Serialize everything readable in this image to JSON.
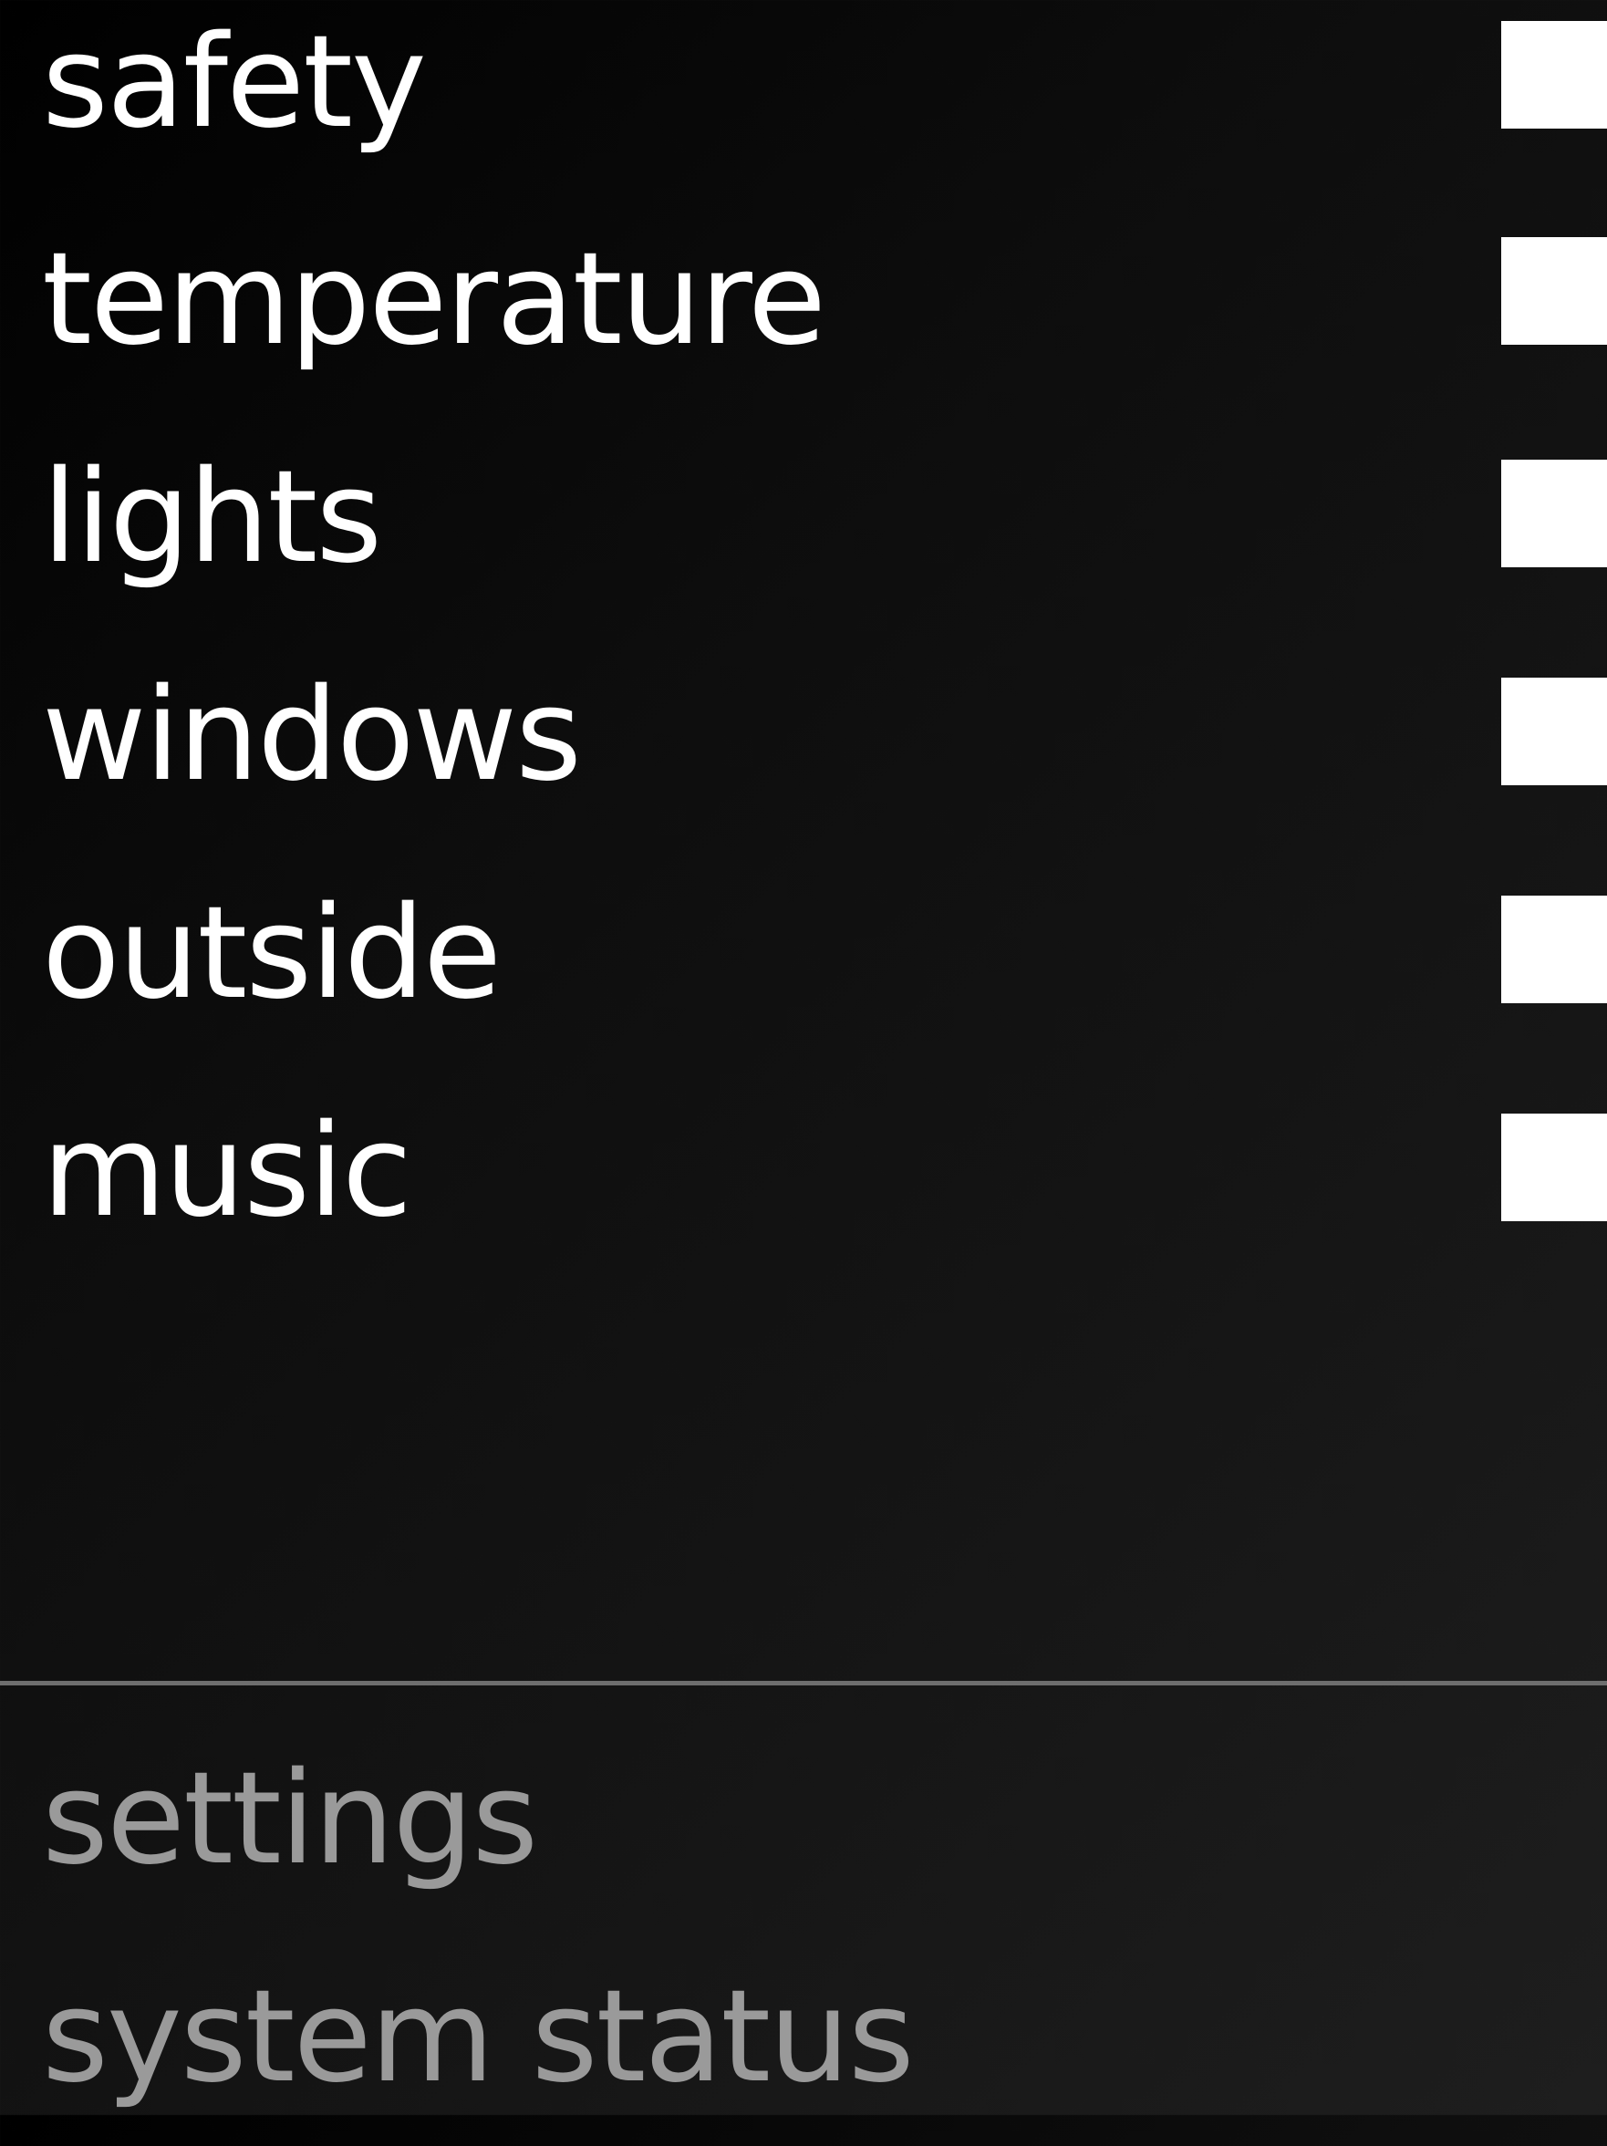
{
  "menu": {
    "items": [
      {
        "label": "safety",
        "icon": "toggle-tile"
      },
      {
        "label": "temperature",
        "icon": "toggle-tile"
      },
      {
        "label": "lights",
        "icon": "toggle-tile"
      },
      {
        "label": "windows",
        "icon": "toggle-tile"
      },
      {
        "label": "outside",
        "icon": "toggle-tile"
      },
      {
        "label": "music",
        "icon": "toggle-tile"
      }
    ]
  },
  "footer": {
    "items": [
      {
        "label": "settings"
      },
      {
        "label": "system status"
      }
    ]
  },
  "colors": {
    "background": "#0a0a0a",
    "primary_text": "#ffffff",
    "secondary_text": "#9a9a9a",
    "divider": "#6e6e6e",
    "tile": "#ffffff"
  }
}
